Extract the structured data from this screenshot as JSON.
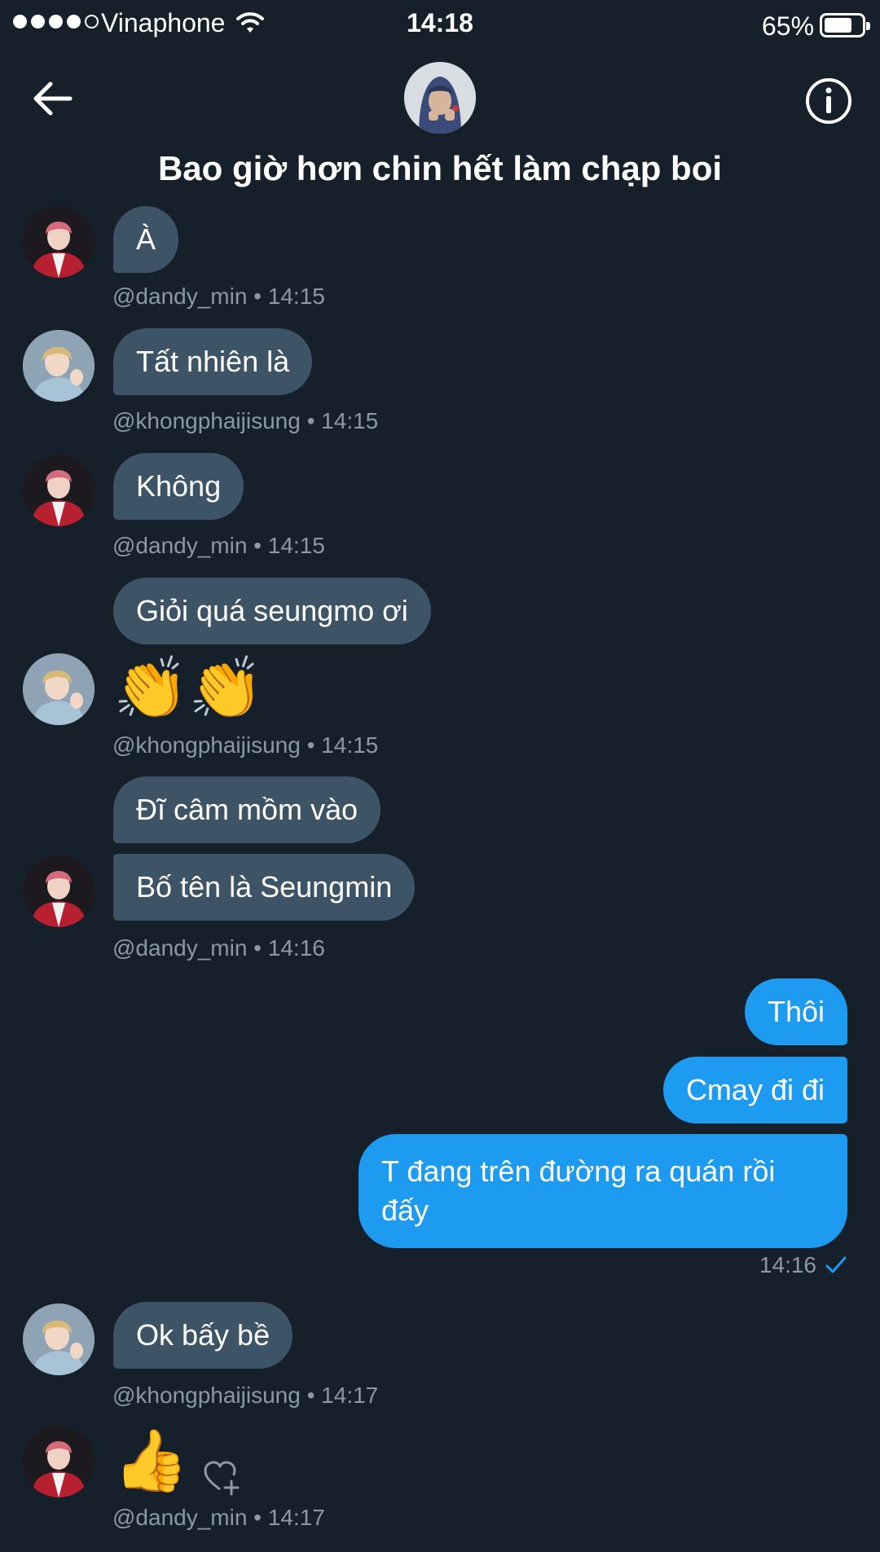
{
  "status_bar": {
    "carrier": "Vinaphone",
    "time": "14:18",
    "battery": "65%"
  },
  "header": {
    "title": "Bao giờ hơn chin hết làm chạp boi",
    "back_icon": "arrow-left-icon",
    "info_icon": "info-circle-icon"
  },
  "colors": {
    "background": "#15202b",
    "incoming_bubble": "#3d5466",
    "outgoing_bubble": "#1d9bf0",
    "meta_text": "#8b98a5"
  },
  "messages": [
    {
      "text": "À"
    },
    {
      "meta": "@dandy_min • 14:15"
    },
    {
      "text": "Tất nhiên là"
    },
    {
      "meta": "@khongphaijisung • 14:15"
    },
    {
      "text": "Không"
    },
    {
      "meta": "@dandy_min • 14:15"
    },
    {
      "text": "Giỏi quá seungmo ơi"
    },
    {
      "text": "👏👏"
    },
    {
      "meta": "@khongphaijisung • 14:15"
    },
    {
      "text": "Đĩ câm mồm vào"
    },
    {
      "text": "Bố tên là Seungmin"
    },
    {
      "meta": "@dandy_min • 14:16"
    },
    {
      "text": "Thôi"
    },
    {
      "text": "Cmay đi đi"
    },
    {
      "text": "T đang trên đường ra quán rồi đấy"
    },
    {
      "meta": "14:16"
    },
    {
      "text": "Ok bấy bề"
    },
    {
      "meta": "@khongphaijisung • 14:17"
    },
    {
      "text": "👍"
    },
    {
      "meta": "@dandy_min • 14:17"
    }
  ]
}
